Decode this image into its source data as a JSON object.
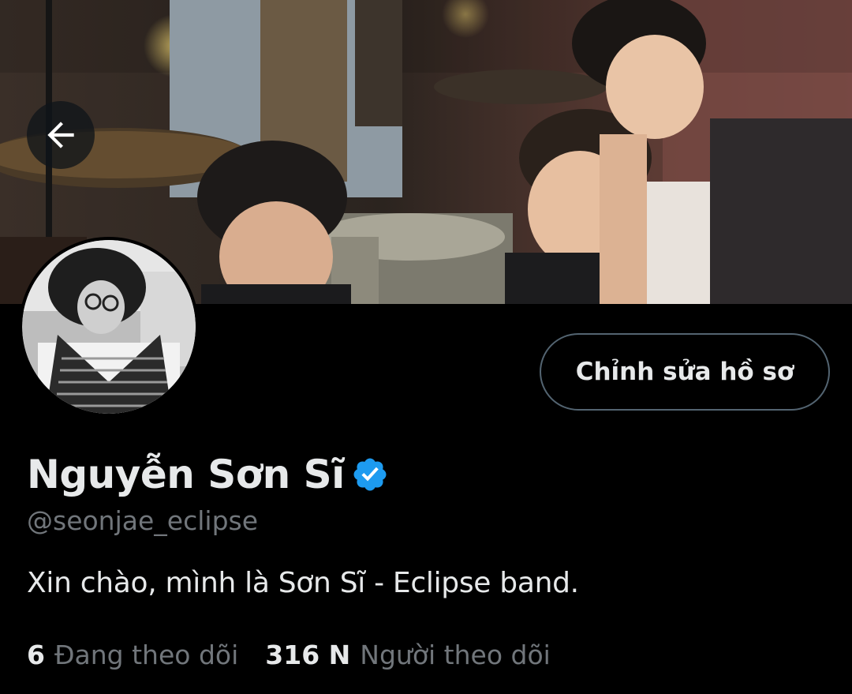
{
  "header": {
    "back_icon": "arrow-left-icon"
  },
  "profile": {
    "display_name": "Nguyễn Sơn Sĩ",
    "verified_icon": "verified-badge-icon",
    "handle": "@seonjae_eclipse",
    "bio": "Xin chào, mình là Sơn Sĩ - Eclipse band.",
    "edit_button_label": "Chỉnh sửa hồ sơ"
  },
  "stats": {
    "following_count": "6",
    "following_label": "Đang theo dõi",
    "followers_count": "316 N",
    "followers_label": "Người theo dõi"
  },
  "colors": {
    "background": "#000000",
    "text_primary": "#e7e9ea",
    "text_secondary": "#71767b",
    "verified_blue": "#1d9bf0",
    "button_border": "#536471"
  }
}
